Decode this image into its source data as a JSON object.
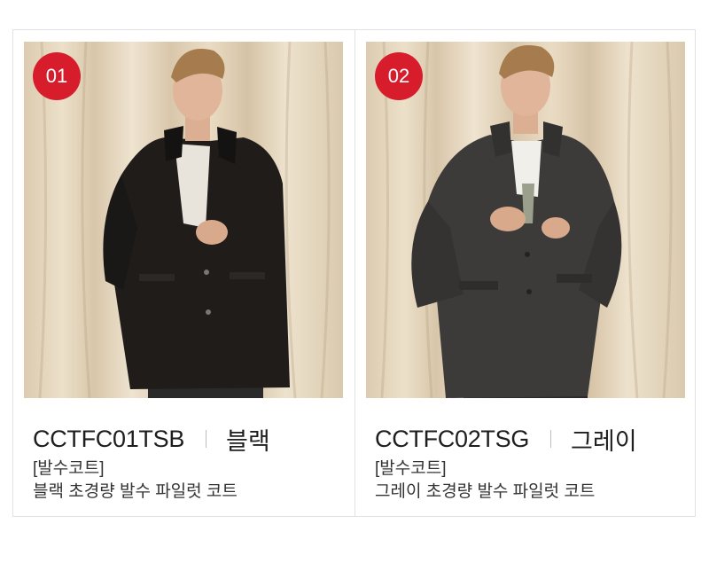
{
  "products": [
    {
      "badge": "01",
      "code": "CCTFC01TSB",
      "color": "블랙",
      "category": "[발수코트]",
      "description": "블랙 초경량 발수 파일럿 코트",
      "coat_color": "#1f1c1a"
    },
    {
      "badge": "02",
      "code": "CCTFC02TSG",
      "color": "그레이",
      "category": "[발수코트]",
      "description": "그레이 초경량 발수 파일럿 코트",
      "coat_color": "#3d3b39"
    }
  ],
  "colors": {
    "badge": "#d71d2b",
    "border": "#e2e2e2",
    "backdrop": "#e6d8bf"
  }
}
